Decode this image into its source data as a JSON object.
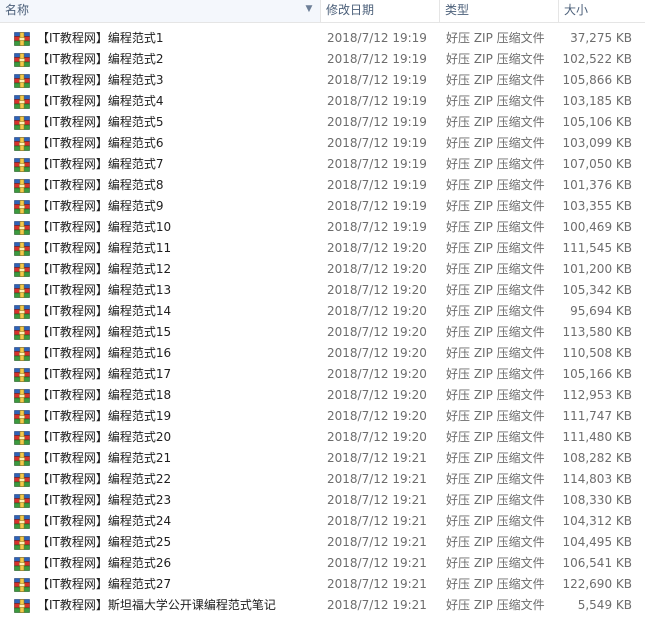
{
  "header": {
    "name": "名称",
    "date": "修改日期",
    "type": "类型",
    "size": "大小"
  },
  "files": [
    {
      "name": "【IT教程网】编程范式1",
      "date": "2018/7/12 19:19",
      "type": "好压 ZIP 压缩文件",
      "size": "37,275 KB"
    },
    {
      "name": "【IT教程网】编程范式2",
      "date": "2018/7/12 19:19",
      "type": "好压 ZIP 压缩文件",
      "size": "102,522 KB"
    },
    {
      "name": "【IT教程网】编程范式3",
      "date": "2018/7/12 19:19",
      "type": "好压 ZIP 压缩文件",
      "size": "105,866 KB"
    },
    {
      "name": "【IT教程网】编程范式4",
      "date": "2018/7/12 19:19",
      "type": "好压 ZIP 压缩文件",
      "size": "103,185 KB"
    },
    {
      "name": "【IT教程网】编程范式5",
      "date": "2018/7/12 19:19",
      "type": "好压 ZIP 压缩文件",
      "size": "105,106 KB"
    },
    {
      "name": "【IT教程网】编程范式6",
      "date": "2018/7/12 19:19",
      "type": "好压 ZIP 压缩文件",
      "size": "103,099 KB"
    },
    {
      "name": "【IT教程网】编程范式7",
      "date": "2018/7/12 19:19",
      "type": "好压 ZIP 压缩文件",
      "size": "107,050 KB"
    },
    {
      "name": "【IT教程网】编程范式8",
      "date": "2018/7/12 19:19",
      "type": "好压 ZIP 压缩文件",
      "size": "101,376 KB"
    },
    {
      "name": "【IT教程网】编程范式9",
      "date": "2018/7/12 19:19",
      "type": "好压 ZIP 压缩文件",
      "size": "103,355 KB"
    },
    {
      "name": "【IT教程网】编程范式10",
      "date": "2018/7/12 19:19",
      "type": "好压 ZIP 压缩文件",
      "size": "100,469 KB"
    },
    {
      "name": "【IT教程网】编程范式11",
      "date": "2018/7/12 19:20",
      "type": "好压 ZIP 压缩文件",
      "size": "111,545 KB"
    },
    {
      "name": "【IT教程网】编程范式12",
      "date": "2018/7/12 19:20",
      "type": "好压 ZIP 压缩文件",
      "size": "101,200 KB"
    },
    {
      "name": "【IT教程网】编程范式13",
      "date": "2018/7/12 19:20",
      "type": "好压 ZIP 压缩文件",
      "size": "105,342 KB"
    },
    {
      "name": "【IT教程网】编程范式14",
      "date": "2018/7/12 19:20",
      "type": "好压 ZIP 压缩文件",
      "size": "95,694 KB"
    },
    {
      "name": "【IT教程网】编程范式15",
      "date": "2018/7/12 19:20",
      "type": "好压 ZIP 压缩文件",
      "size": "113,580 KB"
    },
    {
      "name": "【IT教程网】编程范式16",
      "date": "2018/7/12 19:20",
      "type": "好压 ZIP 压缩文件",
      "size": "110,508 KB"
    },
    {
      "name": "【IT教程网】编程范式17",
      "date": "2018/7/12 19:20",
      "type": "好压 ZIP 压缩文件",
      "size": "105,166 KB"
    },
    {
      "name": "【IT教程网】编程范式18",
      "date": "2018/7/12 19:20",
      "type": "好压 ZIP 压缩文件",
      "size": "112,953 KB"
    },
    {
      "name": "【IT教程网】编程范式19",
      "date": "2018/7/12 19:20",
      "type": "好压 ZIP 压缩文件",
      "size": "111,747 KB"
    },
    {
      "name": "【IT教程网】编程范式20",
      "date": "2018/7/12 19:20",
      "type": "好压 ZIP 压缩文件",
      "size": "111,480 KB"
    },
    {
      "name": "【IT教程网】编程范式21",
      "date": "2018/7/12 19:21",
      "type": "好压 ZIP 压缩文件",
      "size": "108,282 KB"
    },
    {
      "name": "【IT教程网】编程范式22",
      "date": "2018/7/12 19:21",
      "type": "好压 ZIP 压缩文件",
      "size": "114,803 KB"
    },
    {
      "name": "【IT教程网】编程范式23",
      "date": "2018/7/12 19:21",
      "type": "好压 ZIP 压缩文件",
      "size": "108,330 KB"
    },
    {
      "name": "【IT教程网】编程范式24",
      "date": "2018/7/12 19:21",
      "type": "好压 ZIP 压缩文件",
      "size": "104,312 KB"
    },
    {
      "name": "【IT教程网】编程范式25",
      "date": "2018/7/12 19:21",
      "type": "好压 ZIP 压缩文件",
      "size": "104,495 KB"
    },
    {
      "name": "【IT教程网】编程范式26",
      "date": "2018/7/12 19:21",
      "type": "好压 ZIP 压缩文件",
      "size": "106,541 KB"
    },
    {
      "name": "【IT教程网】编程范式27",
      "date": "2018/7/12 19:21",
      "type": "好压 ZIP 压缩文件",
      "size": "122,690 KB"
    },
    {
      "name": "【IT教程网】斯坦福大学公开课编程范式笔记",
      "date": "2018/7/12 19:21",
      "type": "好压 ZIP 压缩文件",
      "size": "5,549 KB"
    }
  ],
  "icon": "zip-archive-icon",
  "colors": {
    "header_text": "#4c607a",
    "sorted_header_bg": "#f4f7fc",
    "secondary_text": "#6d6d6d"
  }
}
